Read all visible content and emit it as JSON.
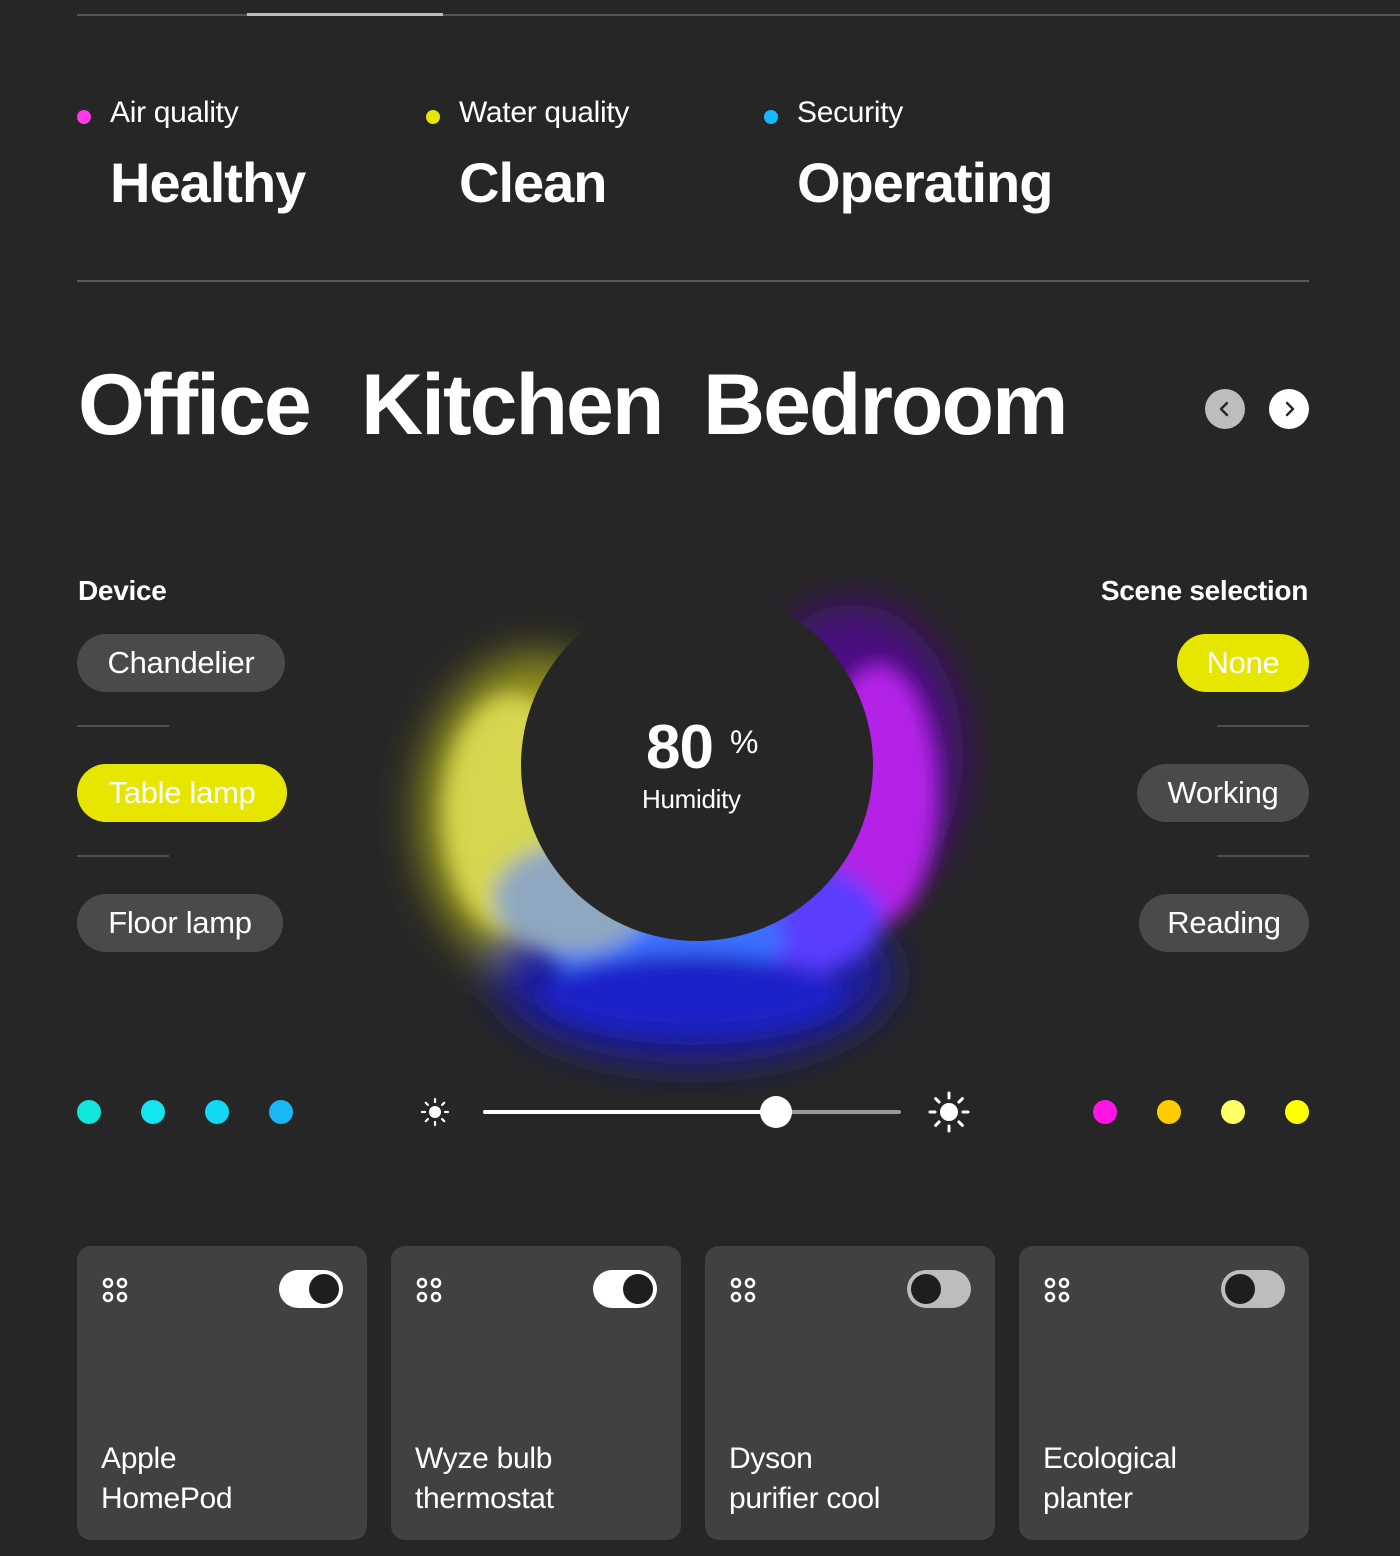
{
  "status": [
    {
      "label": "Air quality",
      "value": "Healthy",
      "color": "#ff38e8"
    },
    {
      "label": "Water quality",
      "value": "Clean",
      "color": "#e6e600"
    },
    {
      "label": "Security",
      "value": "Operating",
      "color": "#18b8ff"
    }
  ],
  "rooms": {
    "tabs": [
      "Office",
      "Kitchen",
      "Bedroom"
    ],
    "active": "Office"
  },
  "device": {
    "title": "Device",
    "items": [
      "Chandelier",
      "Table lamp",
      "Floor lamp"
    ],
    "active": "Table lamp"
  },
  "scene": {
    "title": "Scene selection",
    "items": [
      "None",
      "Working",
      "Reading"
    ],
    "active": "None"
  },
  "humidity": {
    "value": "80",
    "unit": "%",
    "label": "Humidity"
  },
  "brightness": {
    "level": 0.7
  },
  "cool_swatches": [
    "#12e6d8",
    "#14e4f0",
    "#12d8f4",
    "#18b8f6"
  ],
  "warm_swatches": [
    "#ff14e6",
    "#ffcc00",
    "#ffff66",
    "#ffff00"
  ],
  "accent_color": "#e6e600",
  "devices": [
    {
      "name_line1": "Apple",
      "name_line2": "HomePod",
      "on": true
    },
    {
      "name_line1": "Wyze bulb",
      "name_line2": "thermostat",
      "on": true
    },
    {
      "name_line1": "Dyson",
      "name_line2": "purifier cool",
      "on": false
    },
    {
      "name_line1": "Ecological",
      "name_line2": "planter",
      "on": false
    }
  ]
}
